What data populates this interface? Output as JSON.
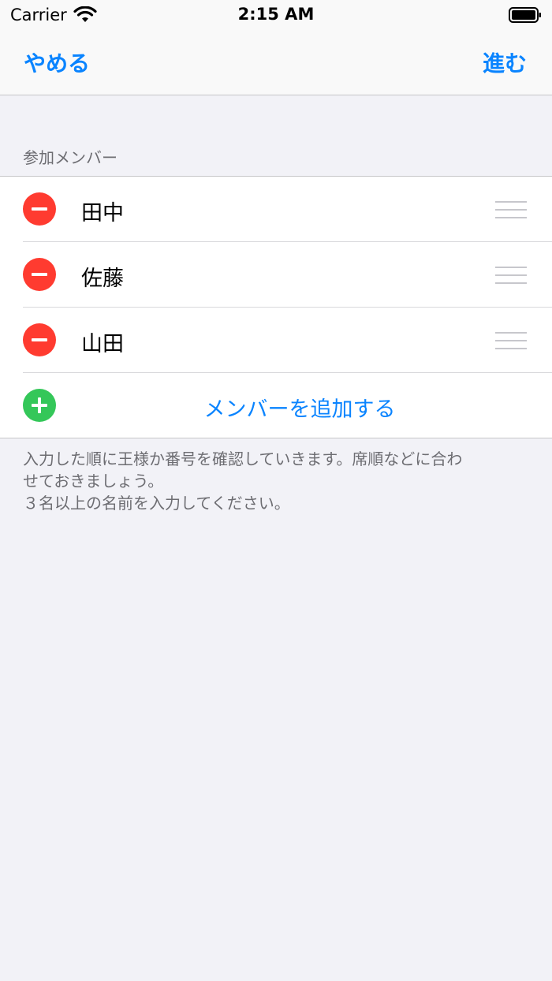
{
  "status_bar": {
    "carrier": "Carrier",
    "time": "2:15 AM"
  },
  "nav": {
    "cancel_label": "やめる",
    "next_label": "進む"
  },
  "section": {
    "header": "参加メンバー",
    "members": [
      {
        "name": "田中"
      },
      {
        "name": "佐藤"
      },
      {
        "name": "山田"
      }
    ],
    "add_label": "メンバーを追加する"
  },
  "footer": {
    "lines": [
      "入力した順に王様か番号を確認していきます。席順などに合わ",
      "せておきましょう。",
      "３名以上の名前を入力してください。"
    ]
  },
  "colors": {
    "accent": "#0a84ff",
    "delete": "#ff3b30",
    "add": "#34c759"
  }
}
